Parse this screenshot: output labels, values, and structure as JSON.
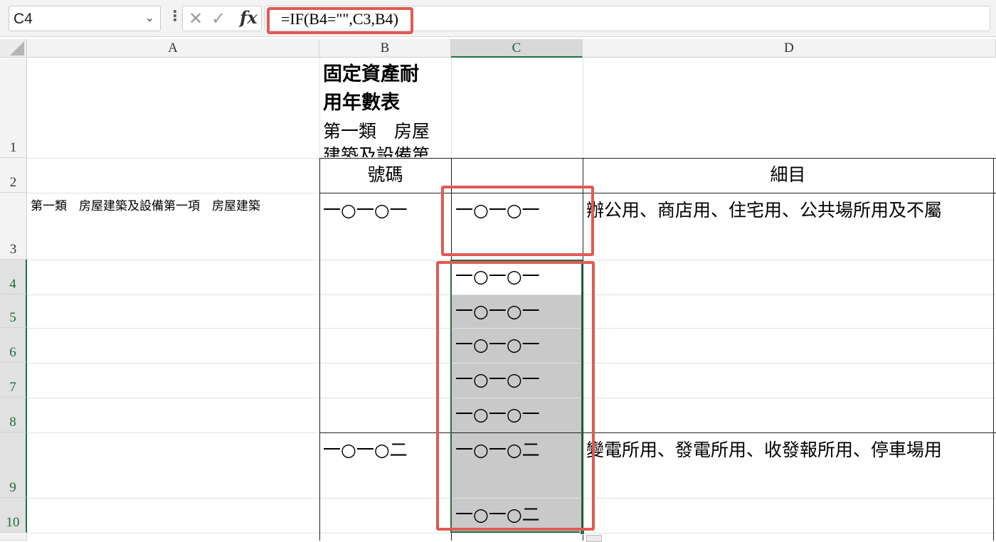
{
  "formula_bar": {
    "name_box": "C4",
    "cancel_icon": "✕",
    "enter_icon": "✓",
    "fx_label": "fx",
    "formula": "=IF(B4=\"\",C3,B4)"
  },
  "columns": [
    "A",
    "B",
    "C",
    "D"
  ],
  "rows": [
    "1",
    "2",
    "3",
    "4",
    "5",
    "6",
    "7",
    "8",
    "9",
    "10"
  ],
  "cells": {
    "B1_line1": "固定資產耐",
    "B1_line2": "用年數表",
    "B1_line3": "第一類　房屋",
    "B1_line4": "建築及設備第",
    "B2": "號碼",
    "D2": "細目",
    "A3": "第一類　房屋建築及設備第一項　房屋建築",
    "B3": "一○一○一",
    "C3": "一○一○一",
    "D3": "辦公用、商店用、住宅用、公共場所用及不屬",
    "C4": "一○一○一",
    "C5": "一○一○一",
    "C6": "一○一○一",
    "C7": "一○一○一",
    "C8": "一○一○一",
    "B9": "一○一○二",
    "C9": "一○一○二",
    "D9": "變電所用、發電所用、收發報所用、停車場用",
    "C10": "一○一○二"
  },
  "selection": {
    "active_cell": "C4",
    "range": "C4:C10"
  },
  "colors": {
    "highlight": "#e05a55",
    "selection": "#1e7145",
    "selected_fill": "#c9c9c9"
  }
}
